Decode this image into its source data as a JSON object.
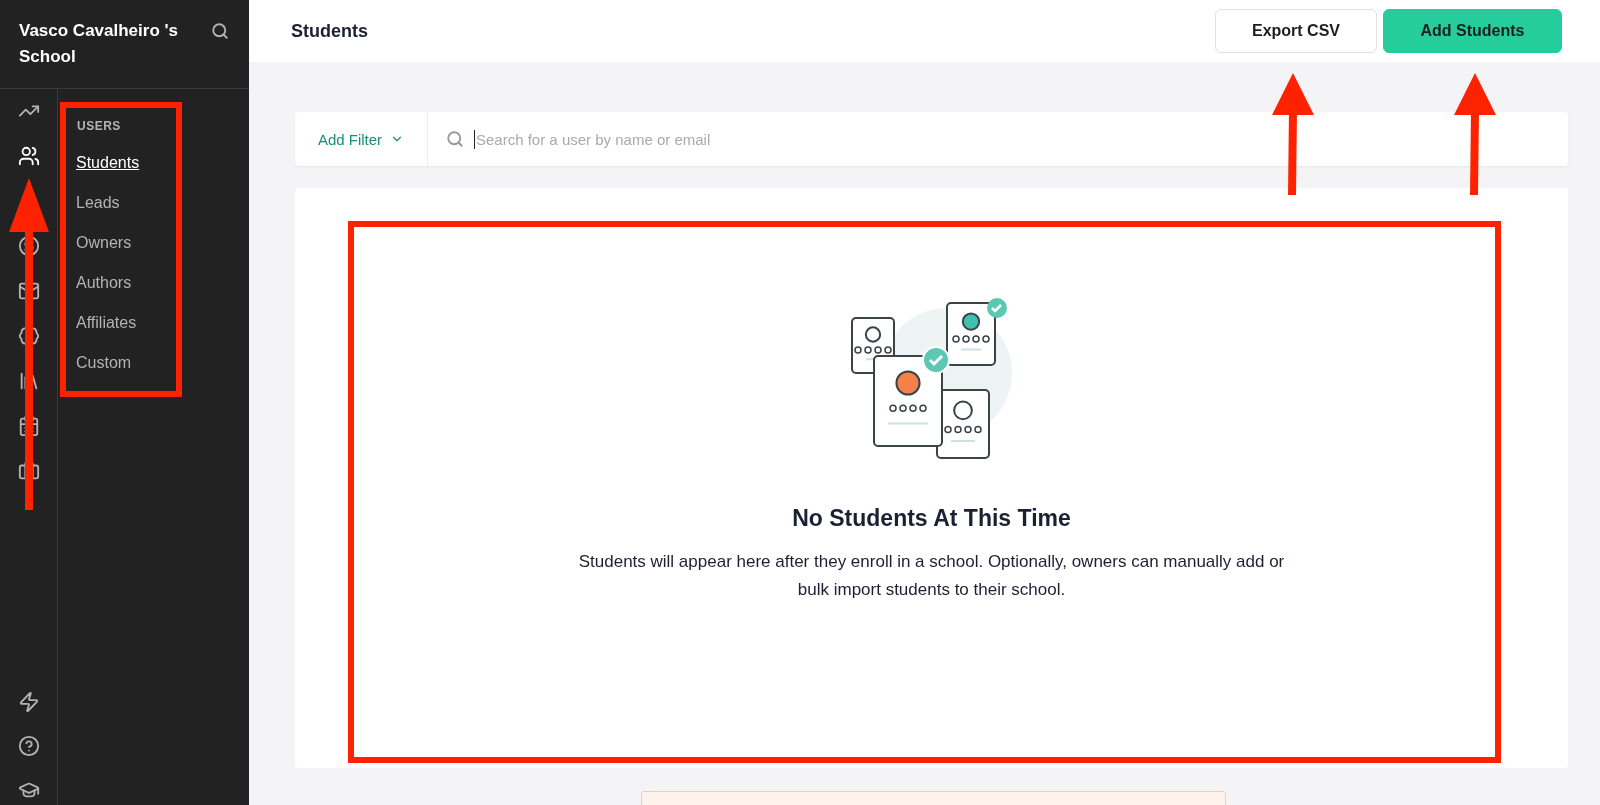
{
  "sidebar": {
    "school_name": "Vasco Cavalheiro 's School",
    "rail_icons": [
      {
        "kind": "chart",
        "selected": false
      },
      {
        "kind": "users",
        "selected": true
      },
      {
        "kind": "gap"
      },
      {
        "kind": "dollar",
        "selected": false
      },
      {
        "kind": "mail",
        "selected": false
      },
      {
        "kind": "badge",
        "selected": false
      },
      {
        "kind": "library",
        "selected": false
      },
      {
        "kind": "calendar",
        "selected": false
      },
      {
        "kind": "briefcase",
        "selected": false
      }
    ],
    "bottom_icons": [
      {
        "kind": "zap"
      },
      {
        "kind": "help"
      },
      {
        "kind": "cap"
      }
    ],
    "section": "USERS",
    "items": [
      {
        "label": "Students",
        "selected": true
      },
      {
        "label": "Leads",
        "selected": false
      },
      {
        "label": "Owners",
        "selected": false
      },
      {
        "label": "Authors",
        "selected": false
      },
      {
        "label": "Affiliates",
        "selected": false
      },
      {
        "label": "Custom",
        "selected": false
      }
    ]
  },
  "header": {
    "title": "Students",
    "buttons": [
      {
        "label": "Export CSV",
        "kind": "secondary"
      },
      {
        "label": "Add Students",
        "kind": "primary"
      }
    ]
  },
  "filter": {
    "label": "Add Filter",
    "placeholder": "Search for a user by name or email"
  },
  "empty_state": {
    "title": "No Students At This Time",
    "text": "Students will appear here after they enroll in a school. Optionally, owners can manually add or bulk import students to their school."
  }
}
